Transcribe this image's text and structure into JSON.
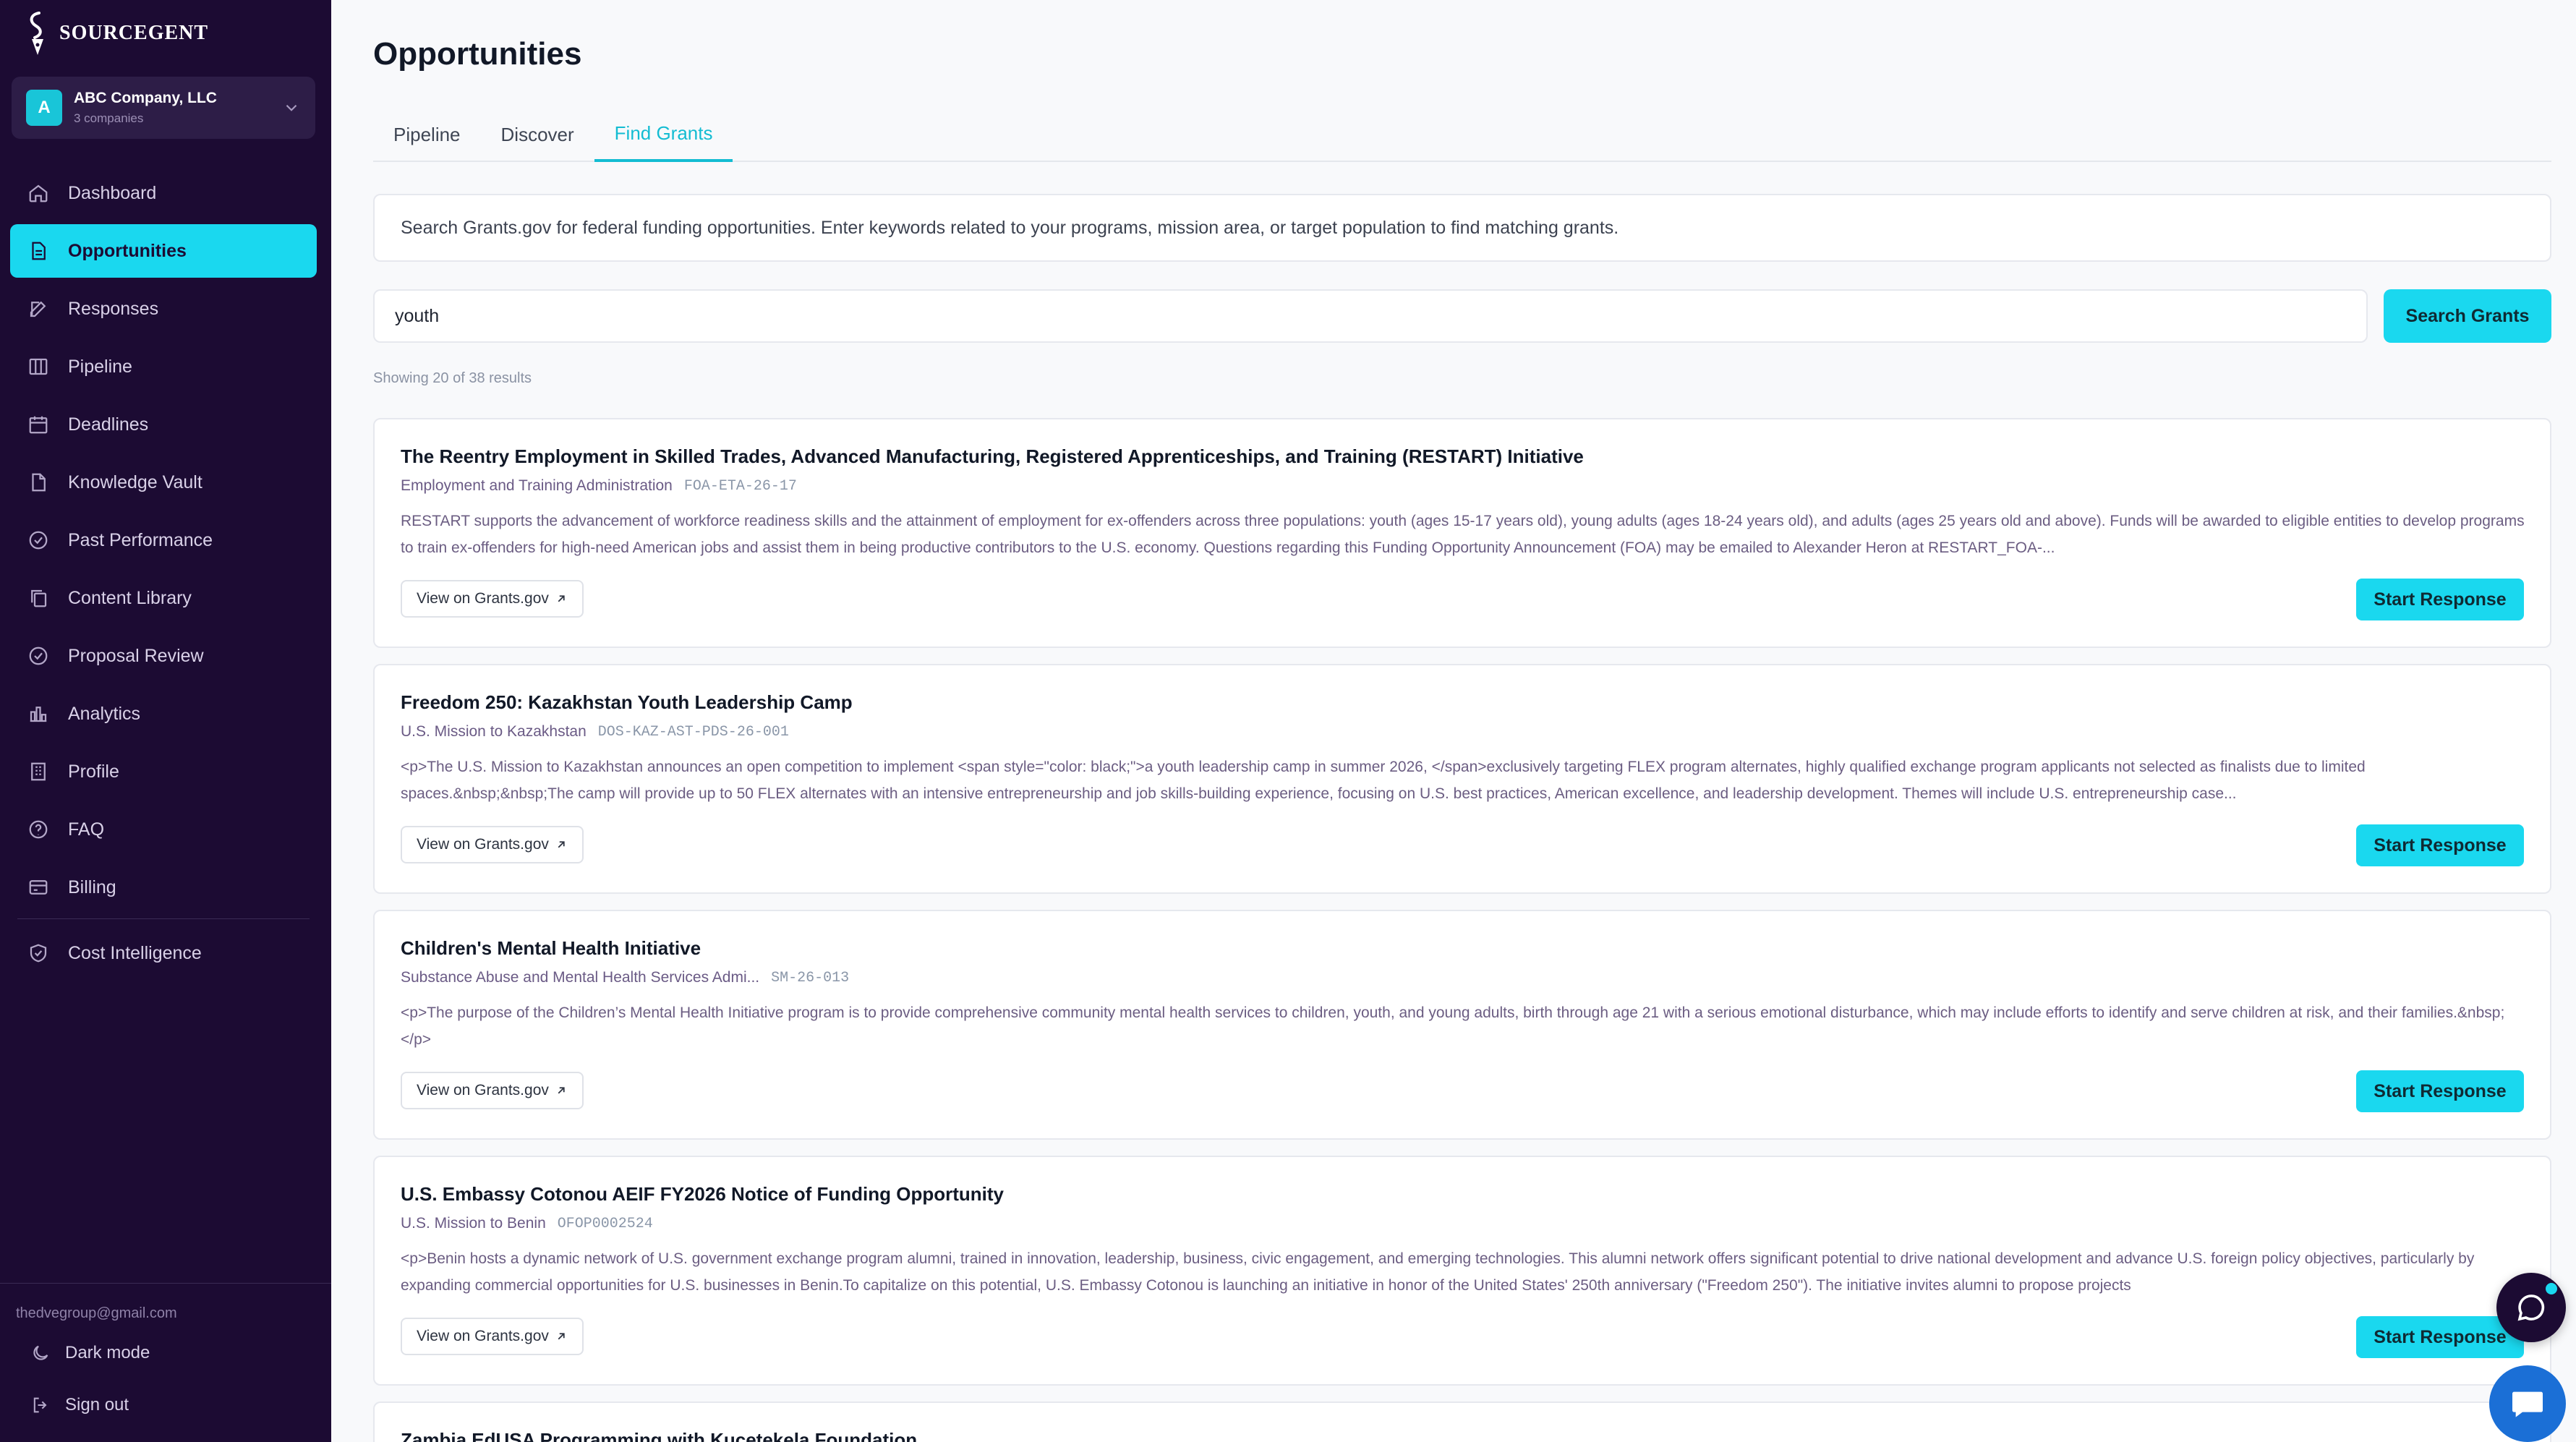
{
  "brand": {
    "name": "SOURCEGENT"
  },
  "company": {
    "avatar": "A",
    "name": "ABC Company, LLC",
    "sub": "3 companies"
  },
  "nav": {
    "items": [
      {
        "label": "Dashboard",
        "icon": "home-icon"
      },
      {
        "label": "Opportunities",
        "icon": "document-icon"
      },
      {
        "label": "Responses",
        "icon": "edit-icon"
      },
      {
        "label": "Pipeline",
        "icon": "columns-icon"
      },
      {
        "label": "Deadlines",
        "icon": "calendar-icon"
      },
      {
        "label": "Knowledge Vault",
        "icon": "file-icon"
      },
      {
        "label": "Past Performance",
        "icon": "check-circle-icon"
      },
      {
        "label": "Content Library",
        "icon": "copy-icon"
      },
      {
        "label": "Proposal Review",
        "icon": "check-badge-icon"
      },
      {
        "label": "Analytics",
        "icon": "bar-chart-icon"
      },
      {
        "label": "Profile",
        "icon": "building-icon"
      },
      {
        "label": "FAQ",
        "icon": "help-circle-icon"
      },
      {
        "label": "Billing",
        "icon": "credit-card-icon"
      },
      {
        "label": "Cost Intelligence",
        "icon": "shield-check-icon"
      }
    ]
  },
  "user": {
    "email": "thedvegroup@gmail.com",
    "dark_mode": "Dark mode",
    "sign_out": "Sign out"
  },
  "page": {
    "title": "Opportunities",
    "tabs": [
      "Pipeline",
      "Discover",
      "Find Grants"
    ],
    "info": "Search Grants.gov for federal funding opportunities. Enter keywords related to your programs, mission area, or target population to find matching grants.",
    "search_value": "youth",
    "search_button": "Search Grants",
    "results_count": "Showing 20 of 38 results"
  },
  "results": [
    {
      "title": "The Reentry Employment in Skilled Trades, Advanced Manufacturing, Registered Apprenticeships, and Training (RESTART) Initiative",
      "agency": "Employment and Training Administration",
      "code": "FOA-ETA-26-17",
      "desc": "RESTART supports the advancement of workforce readiness skills and the attainment of employment for ex-offenders across three populations: youth (ages 15-17 years old), young adults (ages 18-24 years old), and adults (ages 25 years old and above). Funds will be awarded to eligible entities to develop programs to train ex-offenders for high-need American jobs and assist them in being productive contributors to the U.S. economy. Questions regarding this Funding Opportunity Announcement (FOA) may be emailed to Alexander Heron at RESTART_FOA-...",
      "view": "View on Grants.gov",
      "start": "Start Response"
    },
    {
      "title": "Freedom 250: Kazakhstan Youth Leadership Camp",
      "agency": "U.S. Mission to Kazakhstan",
      "code": "DOS-KAZ-AST-PDS-26-001",
      "desc": "<p>The U.S. Mission to Kazakhstan announces an open competition to implement <span style=\"color: black;\">a youth leadership camp in summer 2026, </span>exclusively targeting FLEX program alternates, highly qualified exchange program applicants not selected as finalists due to limited spaces.&nbsp;&nbsp;The camp will provide up to 50 FLEX alternates with an intensive entrepreneurship and job skills-building experience, focusing on U.S. best practices, American excellence, and leadership development. Themes will include U.S. entrepreneurship case...",
      "view": "View on Grants.gov",
      "start": "Start Response"
    },
    {
      "title": "Children's Mental Health Initiative",
      "agency": "Substance Abuse and Mental Health Services Admi...",
      "code": "SM-26-013",
      "desc": "<p>The purpose of the Children’s Mental Health Initiative program is to provide comprehensive community mental health services to children, youth, and young adults, birth through age 21 with a serious emotional disturbance, which may include efforts to identify and serve children at risk, and their families.&nbsp;</p>",
      "view": "View on Grants.gov",
      "start": "Start Response"
    },
    {
      "title": "U.S. Embassy Cotonou AEIF FY2026 Notice of Funding Opportunity",
      "agency": "U.S. Mission to Benin",
      "code": "OFOP0002524",
      "desc": "<p>Benin hosts a dynamic network of U.S. government exchange program alumni, trained in innovation, leadership, business, civic engagement, and emerging technologies. This alumni network offers significant potential to drive national development and advance U.S. foreign policy objectives, particularly by expanding commercial opportunities for U.S. businesses in Benin.To capitalize on this potential, U.S. Embassy Cotonou is launching an initiative in honor of the United States' 250th anniversary (\"Freedom 250\"). The initiative invites alumni to propose projects",
      "view": "View on Grants.gov",
      "start": "Start Response"
    },
    {
      "title": "Zambia EdUSA Programming with Kucetekela Foundation",
      "agency": "",
      "code": "",
      "desc": "",
      "view": "",
      "start": ""
    }
  ],
  "colors": {
    "sidebar_bg": "#1c0b33",
    "accent": "#1ad8ef",
    "active_tab": "#13bcd2"
  }
}
